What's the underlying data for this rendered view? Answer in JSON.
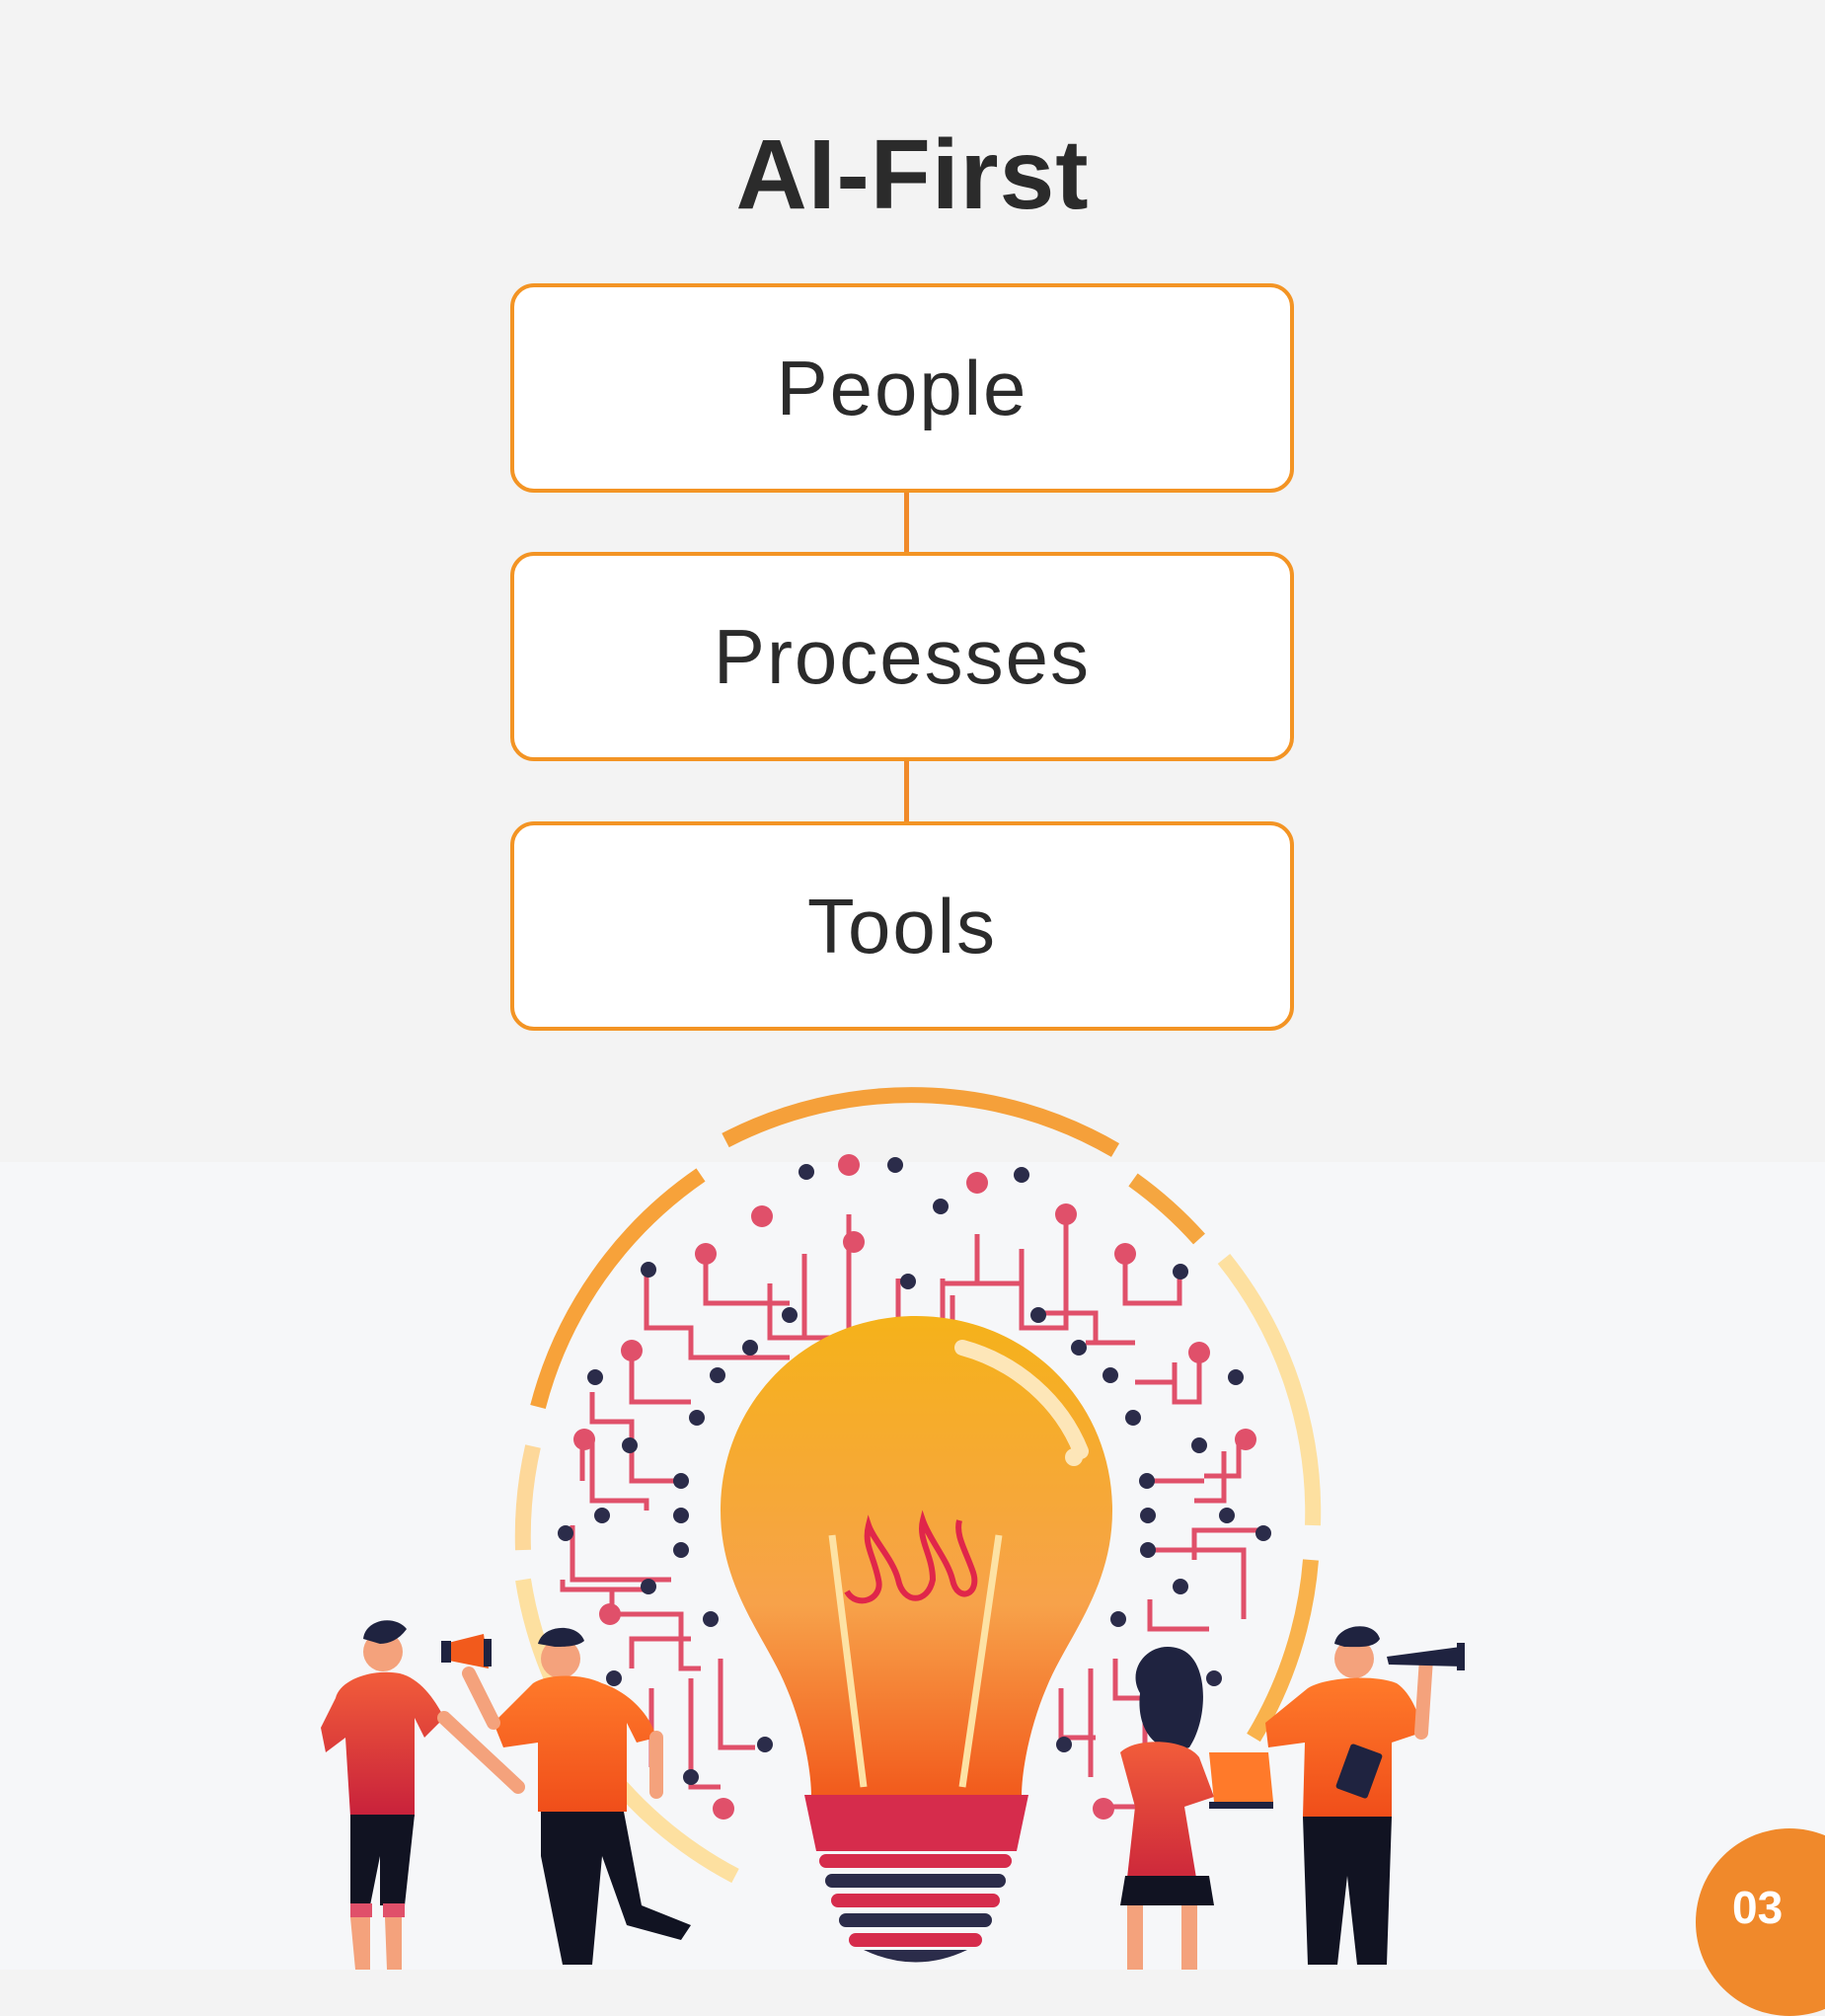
{
  "diagram": {
    "title": "AI-First",
    "boxes": [
      "People",
      "Processes",
      "Tools"
    ]
  },
  "page_number": "03",
  "colors": {
    "accent": "#f39424",
    "text": "#2b2b2b",
    "background_top": "#f3f3f3",
    "background_bottom": "#f6f7f9",
    "badge": "#f0892b"
  },
  "icons": [
    "lightbulb-illustration",
    "circuit-network",
    "megaphone-icon",
    "telescope-icon",
    "laptop-icon",
    "clipboard-icon"
  ]
}
